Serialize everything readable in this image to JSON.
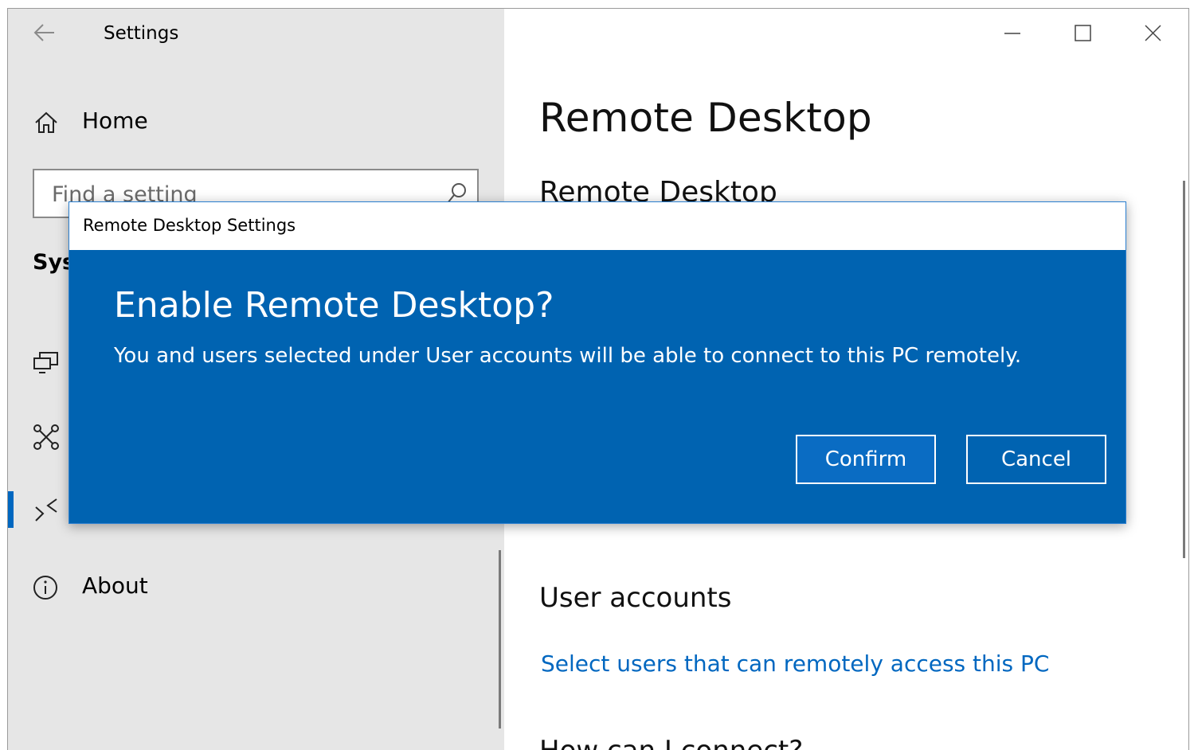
{
  "window": {
    "app_title": "Settings"
  },
  "sidebar": {
    "home_label": "Home",
    "search_placeholder": "Find a setting",
    "section_label": "Sys",
    "items": [
      {
        "icon": "project-icon"
      },
      {
        "icon": "shared-experiences-icon"
      },
      {
        "icon": "remote-desktop-icon",
        "active": true
      }
    ],
    "about_label": "About"
  },
  "main": {
    "page_title": "Remote Desktop",
    "sub_heading": "Remote Desktop",
    "user_accounts_heading": "User accounts",
    "select_users_link": "Select users that can remotely access this PC",
    "cut_heading": "How can I connect?"
  },
  "dialog": {
    "title": "Remote Desktop Settings",
    "heading": "Enable Remote Desktop?",
    "message": "You and users selected under User accounts will be able to connect to this PC remotely.",
    "confirm_label": "Confirm",
    "cancel_label": "Cancel"
  },
  "colors": {
    "accent": "#0063b1",
    "link": "#0067c0",
    "sidebar_bg": "#e6e6e6"
  }
}
